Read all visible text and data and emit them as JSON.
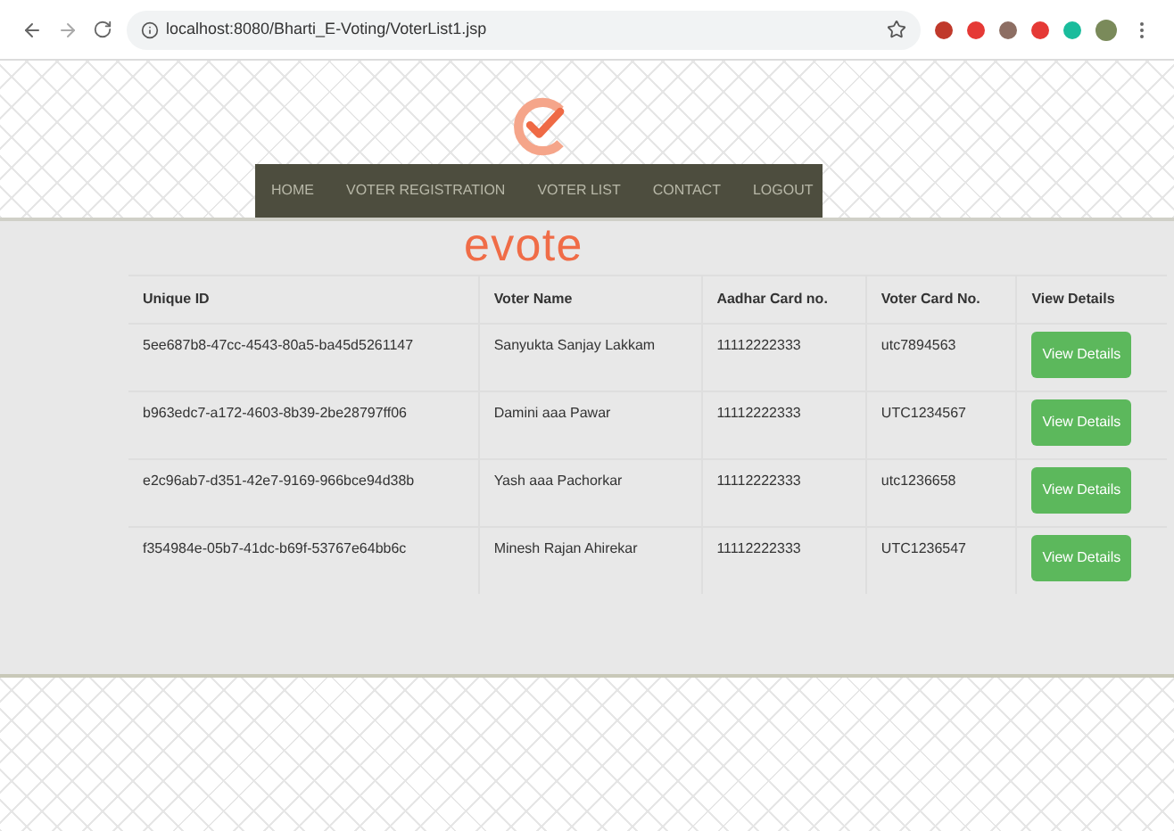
{
  "browser": {
    "url": "localhost:8080/Bharti_E-Voting/VoterList1.jsp"
  },
  "nav": {
    "items": [
      {
        "label": "HOME"
      },
      {
        "label": "VOTER REGISTRATION"
      },
      {
        "label": "VOTER LIST"
      },
      {
        "label": "CONTACT"
      },
      {
        "label": "LOGOUT"
      }
    ]
  },
  "logo": {
    "text": "evote"
  },
  "table": {
    "columns": [
      "Unique ID",
      "Voter Name",
      "Aadhar Card no.",
      "Voter Card No.",
      "View Details"
    ],
    "rows": [
      {
        "cells": [
          "5ee687b8-47cc-4543-80a5-ba45d5261147",
          "Sanyukta Sanjay Lakkam",
          "11112222333",
          "utc7894563"
        ],
        "button": "View Details"
      },
      {
        "cells": [
          "b963edc7-a172-4603-8b39-2be28797ff06",
          "Damini aaa Pawar",
          "11112222333",
          "UTC1234567"
        ],
        "button": "View Details"
      },
      {
        "cells": [
          "e2c96ab7-d351-42e7-9169-966bce94d38b",
          "Yash aaa Pachorkar",
          "11112222333",
          "utc1236658"
        ],
        "button": "View Details"
      },
      {
        "cells": [
          "f354984e-05b7-41dc-b69f-53767e64bb6c",
          "Minesh Rajan Ahirekar",
          "11112222333",
          "UTC1236547"
        ],
        "button": "View Details"
      }
    ]
  }
}
